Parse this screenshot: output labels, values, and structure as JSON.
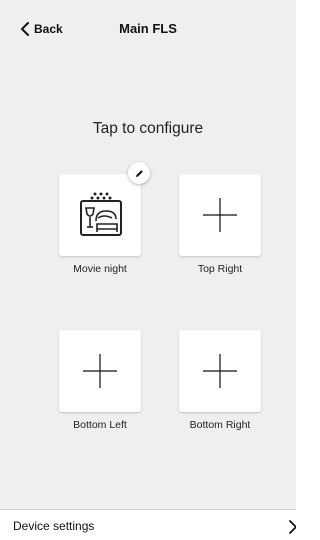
{
  "header": {
    "back_label": "Back",
    "title": "Main FLS"
  },
  "main": {
    "instruction": "Tap to configure",
    "tiles": [
      {
        "label": "Movie night",
        "icon": "movie-night-scene-icon",
        "configured": true
      },
      {
        "label": "Top Right",
        "icon": "plus-icon",
        "configured": false
      },
      {
        "label": "Bottom Left",
        "icon": "plus-icon",
        "configured": false
      },
      {
        "label": "Bottom Right",
        "icon": "plus-icon",
        "configured": false
      }
    ]
  },
  "footer": {
    "label": "Device settings",
    "icon": "chevron-right-icon"
  },
  "colors": {
    "background": "#efefef",
    "tile": "#ffffff",
    "text": "#111111"
  }
}
